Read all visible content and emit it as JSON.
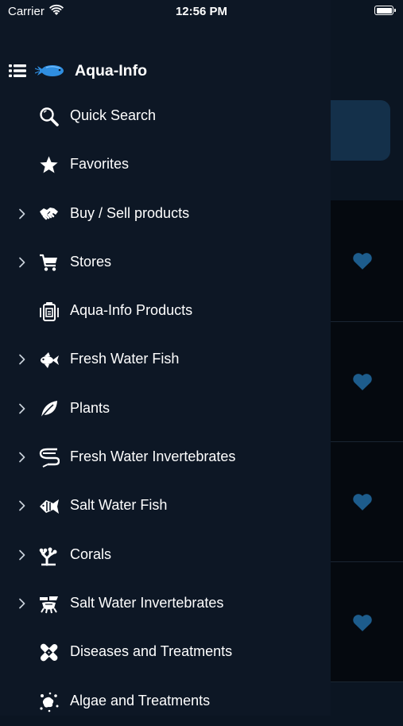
{
  "status_bar": {
    "carrier": "Carrier",
    "time": "12:56 PM"
  },
  "drawer": {
    "title": "Aqua-Info",
    "items": [
      {
        "label": "Quick Search",
        "icon": "search-icon",
        "expandable": false
      },
      {
        "label": "Favorites",
        "icon": "star-icon",
        "expandable": false
      },
      {
        "label": "Buy / Sell products",
        "icon": "handshake-icon",
        "expandable": true
      },
      {
        "label": "Stores",
        "icon": "cart-icon",
        "expandable": true
      },
      {
        "label": "Aqua-Info Products",
        "icon": "products-icon",
        "expandable": false
      },
      {
        "label": "Fresh Water Fish",
        "icon": "freshwater-fish-icon",
        "expandable": true
      },
      {
        "label": "Plants",
        "icon": "plant-leaf-icon",
        "expandable": true
      },
      {
        "label": "Fresh Water Invertebrates",
        "icon": "shrimp-icon",
        "expandable": true
      },
      {
        "label": "Salt Water Fish",
        "icon": "saltwater-fish-icon",
        "expandable": true
      },
      {
        "label": "Corals",
        "icon": "coral-icon",
        "expandable": true
      },
      {
        "label": "Salt Water Invertebrates",
        "icon": "crab-icon",
        "expandable": true
      },
      {
        "label": "Diseases and Treatments",
        "icon": "bandage-icon",
        "expandable": false
      },
      {
        "label": "Algae and Treatments",
        "icon": "algae-icon",
        "expandable": false
      }
    ]
  },
  "colors": {
    "drawer_bg": "#0d1725",
    "heart": "#1d5c8c",
    "logo": "#2f8ee0"
  }
}
